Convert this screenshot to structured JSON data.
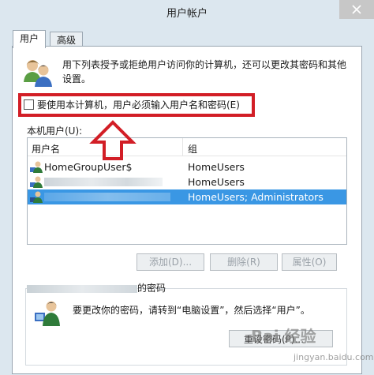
{
  "window": {
    "title": "用户帐户"
  },
  "tabs": [
    {
      "label": "用户",
      "active": true
    },
    {
      "label": "高级",
      "active": false
    }
  ],
  "intro_text": "用下列表授予或拒绝用户访问你的计算机，还可以更改其密码和其他设置。",
  "require_password_checkbox": {
    "label": "要使用本计算机，用户必须输入用户名和密码(E)",
    "checked": false
  },
  "user_list": {
    "label": "本机用户(U):",
    "columns": {
      "name": "用户名",
      "group": "组"
    },
    "rows": [
      {
        "name": "HomeGroupUser$",
        "group": "HomeUsers",
        "selected": false,
        "name_obscured": false
      },
      {
        "name": "",
        "group": "HomeUsers",
        "selected": false,
        "name_obscured": true
      },
      {
        "name": "",
        "group": "HomeUsers; Administrators",
        "selected": true,
        "name_obscured": true
      }
    ]
  },
  "buttons": {
    "add": "添加(D)...",
    "delete": "删除(R)",
    "properties": "属性(O)"
  },
  "password_section": {
    "legend_suffix": "的密码",
    "text": "要更改你的密码，请转到“电脑设置”，然后选择“用户”。",
    "reset_button": "重设密码(P)..."
  },
  "watermark": {
    "brand": "Bai 经验",
    "url": "jingyan.baidu.com"
  },
  "colors": {
    "highlight_box": "#d21e26",
    "selection": "#3a97e4"
  }
}
